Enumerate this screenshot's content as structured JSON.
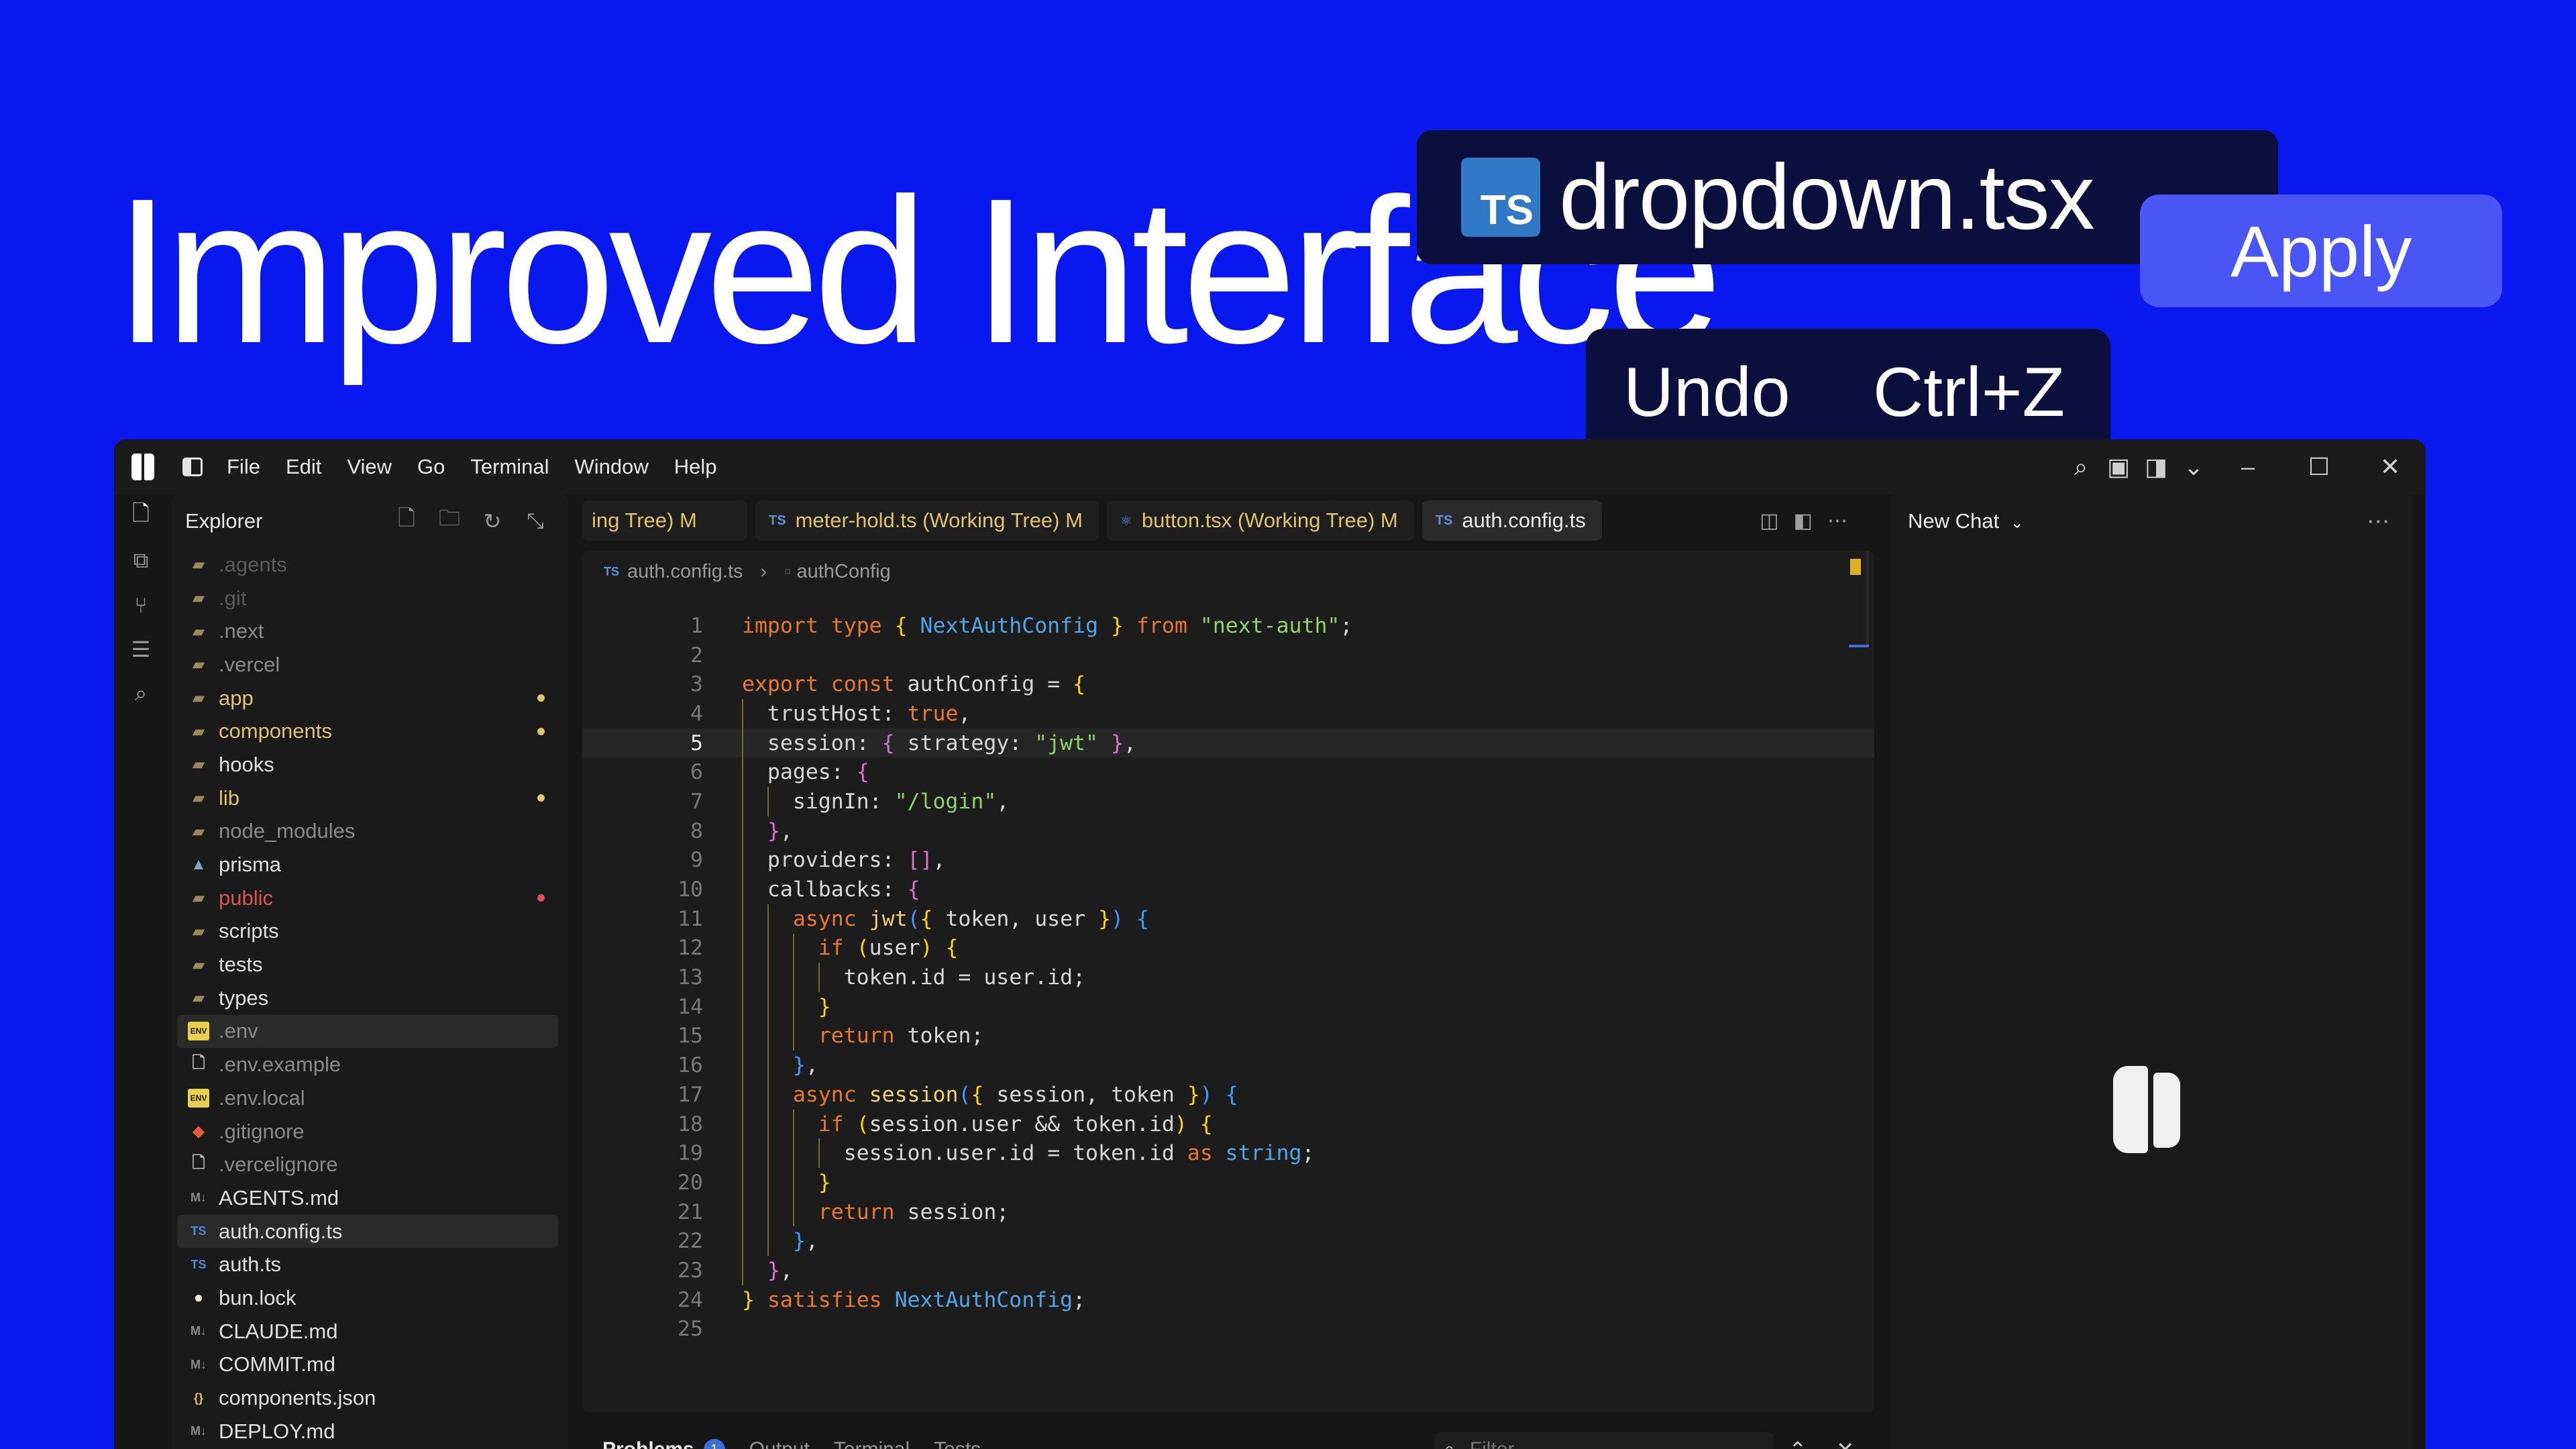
{
  "hero": {
    "title": "Improved Interface",
    "file_chip": {
      "badge": "TS",
      "name": "dropdown.tsx"
    },
    "apply_label": "Apply",
    "undo_label": "Undo",
    "undo_shortcut": "Ctrl+Z"
  },
  "menubar": {
    "items": [
      "File",
      "Edit",
      "View",
      "Go",
      "Terminal",
      "Window",
      "Help"
    ]
  },
  "explorer": {
    "title": "Explorer",
    "items": [
      {
        "label": ".agents",
        "icon": "folder-icon",
        "style": "faded"
      },
      {
        "label": ".git",
        "icon": "folder-icon",
        "style": "faded"
      },
      {
        "label": ".next",
        "icon": "folder-icon",
        "style": "dim"
      },
      {
        "label": ".vercel",
        "icon": "folder-icon",
        "style": "dim"
      },
      {
        "label": "app",
        "icon": "folder-icon",
        "color": "#e0c36a",
        "dot": "#e0c36a"
      },
      {
        "label": "components",
        "icon": "folder-icon",
        "color": "#e0c36a",
        "dot": "#e0c36a"
      },
      {
        "label": "hooks",
        "icon": "folder-icon"
      },
      {
        "label": "lib",
        "icon": "folder-icon",
        "color": "#e0c36a",
        "dot": "#e0c36a"
      },
      {
        "label": "node_modules",
        "icon": "folder-icon",
        "style": "dim"
      },
      {
        "label": "prisma",
        "icon": "prisma-icon"
      },
      {
        "label": "public",
        "icon": "folder-icon",
        "color": "#e05252",
        "dot": "#e05252"
      },
      {
        "label": "scripts",
        "icon": "folder-icon"
      },
      {
        "label": "tests",
        "icon": "folder-icon"
      },
      {
        "label": "types",
        "icon": "folder-icon"
      },
      {
        "label": ".env",
        "icon": "env-icon",
        "style": "dim",
        "selected": true
      },
      {
        "label": ".env.example",
        "icon": "file-icon",
        "style": "dim"
      },
      {
        "label": ".env.local",
        "icon": "env-icon",
        "style": "dim"
      },
      {
        "label": ".gitignore",
        "icon": "git-icon",
        "style": "dim"
      },
      {
        "label": ".vercelignore",
        "icon": "file-icon",
        "style": "dim"
      },
      {
        "label": "AGENTS.md",
        "icon": "markdown-icon"
      },
      {
        "label": "auth.config.ts",
        "icon": "typescript-icon",
        "selected": true
      },
      {
        "label": "auth.ts",
        "icon": "typescript-icon"
      },
      {
        "label": "bun.lock",
        "icon": "bun-icon"
      },
      {
        "label": "CLAUDE.md",
        "icon": "markdown-icon"
      },
      {
        "label": "COMMIT.md",
        "icon": "markdown-icon"
      },
      {
        "label": "components.json",
        "icon": "json-icon"
      },
      {
        "label": "DEPLOY.md",
        "icon": "markdown-icon"
      }
    ]
  },
  "tabs": [
    {
      "label": "ing Tree) M",
      "icon": "",
      "clipped": true
    },
    {
      "label": "meter-hold.ts (Working Tree) M",
      "icon": "TS"
    },
    {
      "label": "button.tsx (Working Tree) M",
      "icon": "⚛"
    },
    {
      "label": "auth.config.ts",
      "icon": "TS",
      "active": true
    }
  ],
  "breadcrumb": {
    "file": "auth.config.ts",
    "symbol": "authConfig"
  },
  "code": {
    "current_line": 5,
    "lines": [
      "import type { NextAuthConfig } from \"next-auth\";",
      "",
      "export const authConfig = {",
      "  trustHost: true,",
      "  session: { strategy: \"jwt\" },",
      "  pages: {",
      "    signIn: \"/login\",",
      "  },",
      "  providers: [],",
      "  callbacks: {",
      "    async jwt({ token, user }) {",
      "      if (user) {",
      "        token.id = user.id;",
      "      }",
      "      return token;",
      "    },",
      "    async session({ session, token }) {",
      "      if (session.user && token.id) {",
      "        session.user.id = token.id as string;",
      "      }",
      "      return session;",
      "    },",
      "  },",
      "} satisfies NextAuthConfig;",
      ""
    ]
  },
  "bottom_panel": {
    "tabs": [
      "Problems",
      "Output",
      "Terminal",
      "Tests"
    ],
    "problems_count": "1",
    "filter_placeholder": "Filter"
  },
  "chat": {
    "title": "New Chat"
  },
  "colors": {
    "background": "#0a18f0",
    "accent": "#4a55f5",
    "ts_badge": "#3178c6"
  }
}
